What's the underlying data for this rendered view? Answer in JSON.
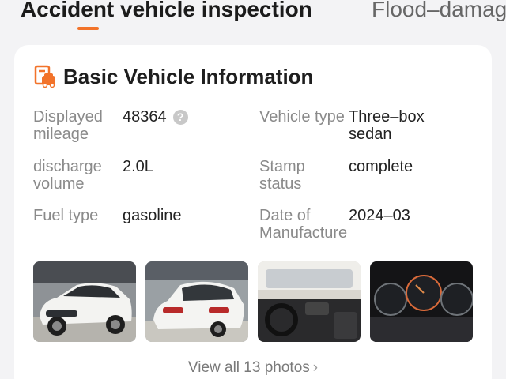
{
  "tabs": [
    {
      "label": "Accident vehicle inspection",
      "active": true
    },
    {
      "label": "Flood–damag",
      "active": false
    }
  ],
  "accent_color": "#f2732a",
  "card": {
    "title": "Basic Vehicle Information",
    "icon": "car-document-icon",
    "fields": [
      {
        "label": "Displayed mileage",
        "value": "48364",
        "help": "?"
      },
      {
        "label": "Vehicle type",
        "value": "Three–box sedan"
      },
      {
        "label": "discharge volume",
        "value": "2.0L"
      },
      {
        "label": "Stamp status",
        "value": "complete"
      },
      {
        "label": "Fuel type",
        "value": "gasoline"
      },
      {
        "label": "Date of Manufacture",
        "value": "2024–03"
      }
    ],
    "photos": [
      {
        "icon": "car-front-photo"
      },
      {
        "icon": "car-rear-photo"
      },
      {
        "icon": "car-interior-photo"
      },
      {
        "icon": "car-dashboard-photo"
      }
    ],
    "view_all": "View all 13 photos"
  }
}
